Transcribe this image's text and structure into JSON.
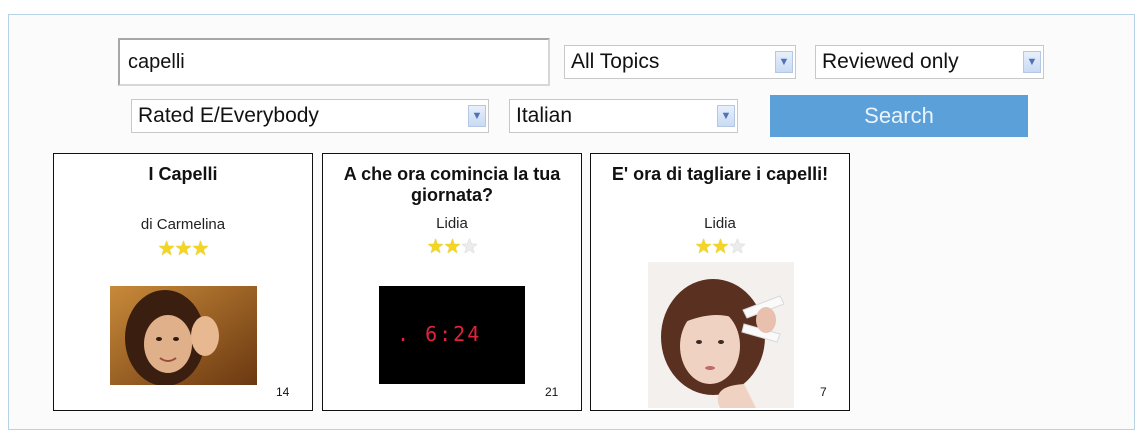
{
  "search": {
    "value": "capelli"
  },
  "filters": {
    "topic": "All Topics",
    "review": "Reviewed only",
    "rating": "Rated E/Everybody",
    "language": "Italian"
  },
  "search_button": "Search",
  "cards": [
    {
      "title": "I Capelli",
      "author": "di Carmelina",
      "rating": 3,
      "max_rating": 3,
      "count": "14",
      "image": "girl-photo"
    },
    {
      "title": "A che ora comincia la tua giornata?",
      "author": "Lidia",
      "rating": 2,
      "max_rating": 3,
      "count": "21",
      "image": "digital-clock",
      "clock_text": ". 6:24"
    },
    {
      "title": "E' ora di tagliare i capelli!",
      "author": "Lidia",
      "rating": 2,
      "max_rating": 3,
      "count": "7",
      "image": "woman-scissors-photo"
    }
  ],
  "icons": {
    "dropdown": "chevron-down-icon",
    "star": "star-icon"
  },
  "colors": {
    "accent": "#5ba0d8",
    "panel_border": "#b9d3e6",
    "star": "#f4d522"
  }
}
